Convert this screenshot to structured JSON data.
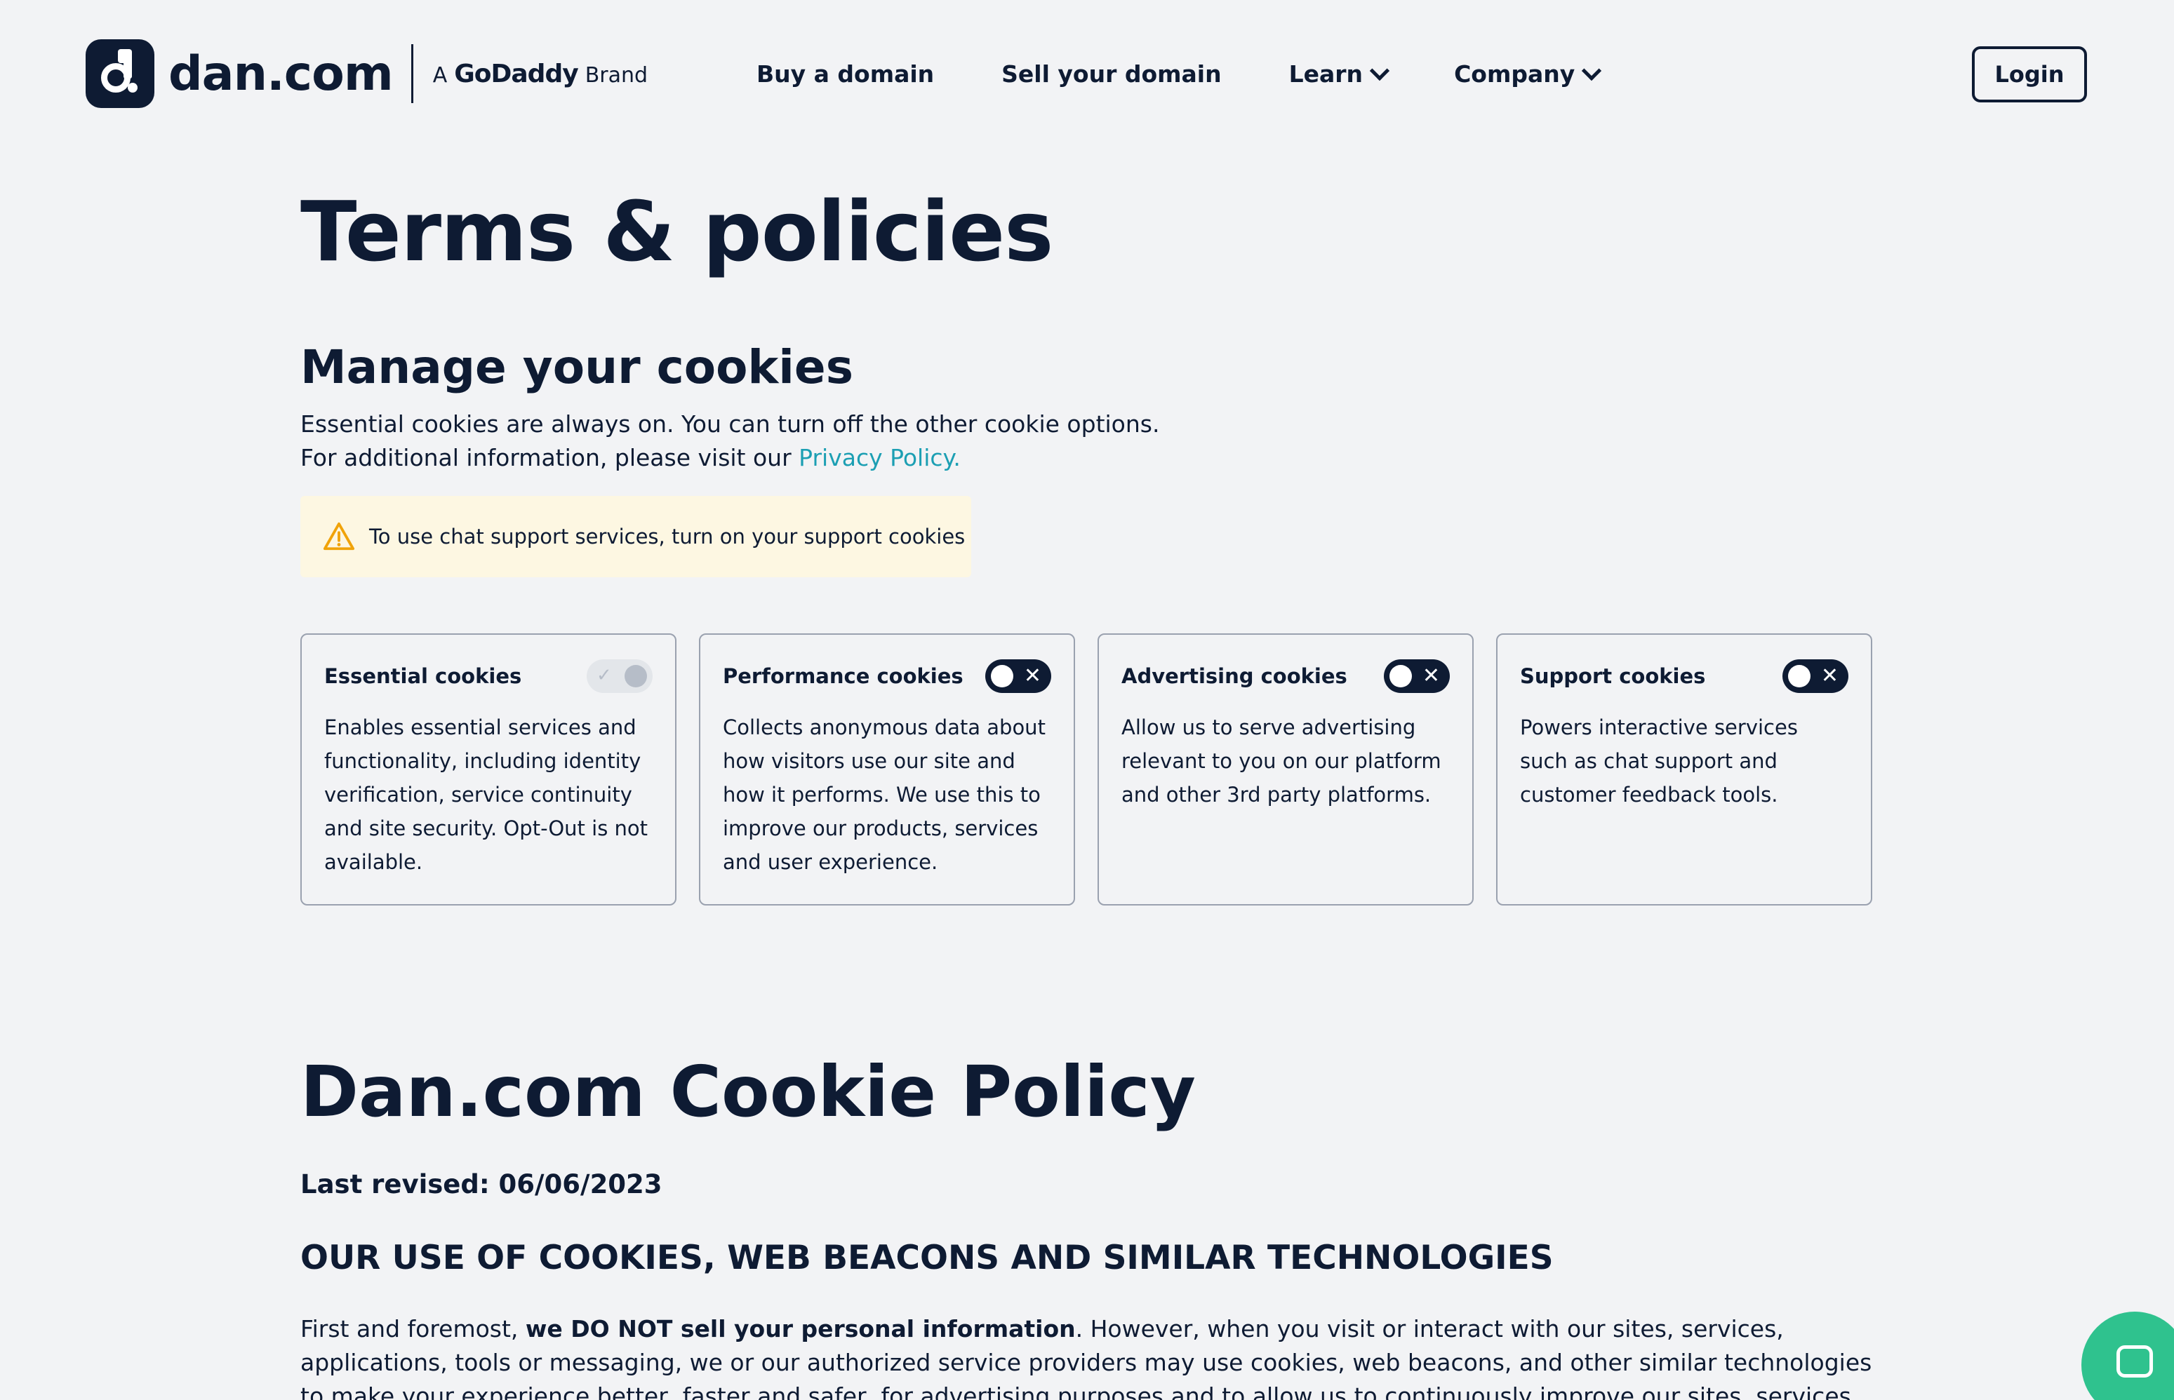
{
  "header": {
    "logo_text": "dan.com",
    "brand_prefix": "A",
    "brand_name": "GoDaddy",
    "brand_suffix": "Brand",
    "nav": [
      {
        "label": "Buy a domain"
      },
      {
        "label": "Sell your domain"
      },
      {
        "label": "Learn"
      },
      {
        "label": "Company"
      }
    ],
    "login_label": "Login"
  },
  "page": {
    "title": "Terms & policies"
  },
  "cookies": {
    "heading": "Manage your cookies",
    "line1": "Essential cookies are always on. You can turn off the other cookie options.",
    "line2_prefix": "For additional information, please visit our ",
    "privacy_link": "Privacy Policy.",
    "alert": "To use chat support services, turn on your support cookies",
    "cards": [
      {
        "title": "Essential cookies",
        "desc": "Enables essential services and functionality, including identity verification, service continuity and site security. Opt-Out is not available.",
        "toggle_state": "locked-on"
      },
      {
        "title": "Performance cookies",
        "desc": "Collects anonymous data about how visitors use our site and how it performs. We use this to improve our products, services and user experience.",
        "toggle_state": "off"
      },
      {
        "title": "Advertising cookies",
        "desc": "Allow us to serve advertising relevant to you on our platform and other 3rd party platforms.",
        "toggle_state": "off"
      },
      {
        "title": "Support cookies",
        "desc": "Powers interactive services such as chat support and customer feedback tools.",
        "toggle_state": "off"
      }
    ]
  },
  "policy": {
    "title": "Dan.com Cookie Policy",
    "revised": "Last revised: 06/06/2023",
    "section_heading": "OUR USE OF COOKIES, WEB BEACONS AND SIMILAR TECHNOLOGIES",
    "para_prefix": "First and foremost, ",
    "para_bold": "we DO NOT sell your personal information",
    "para_rest": ". However, when you visit or interact with our sites, services, applications, tools or messaging, we or our authorized service providers may use cookies, web beacons, and other similar technologies to make your experience better, faster and safer, for advertising purposes and to allow us to continuously improve our sites, services, applications and tools. Any"
  },
  "colors": {
    "navy": "#0e1b33",
    "link": "#1c9fb3",
    "alert_bg": "#fdf7e2",
    "alert_icon": "#f0a30a",
    "chat": "#2fc28e"
  },
  "icons": {
    "alert": "warning-triangle-icon",
    "chat": "chat-bubble-icon",
    "toggle_off": "close-icon",
    "toggle_locked": "check-icon"
  }
}
